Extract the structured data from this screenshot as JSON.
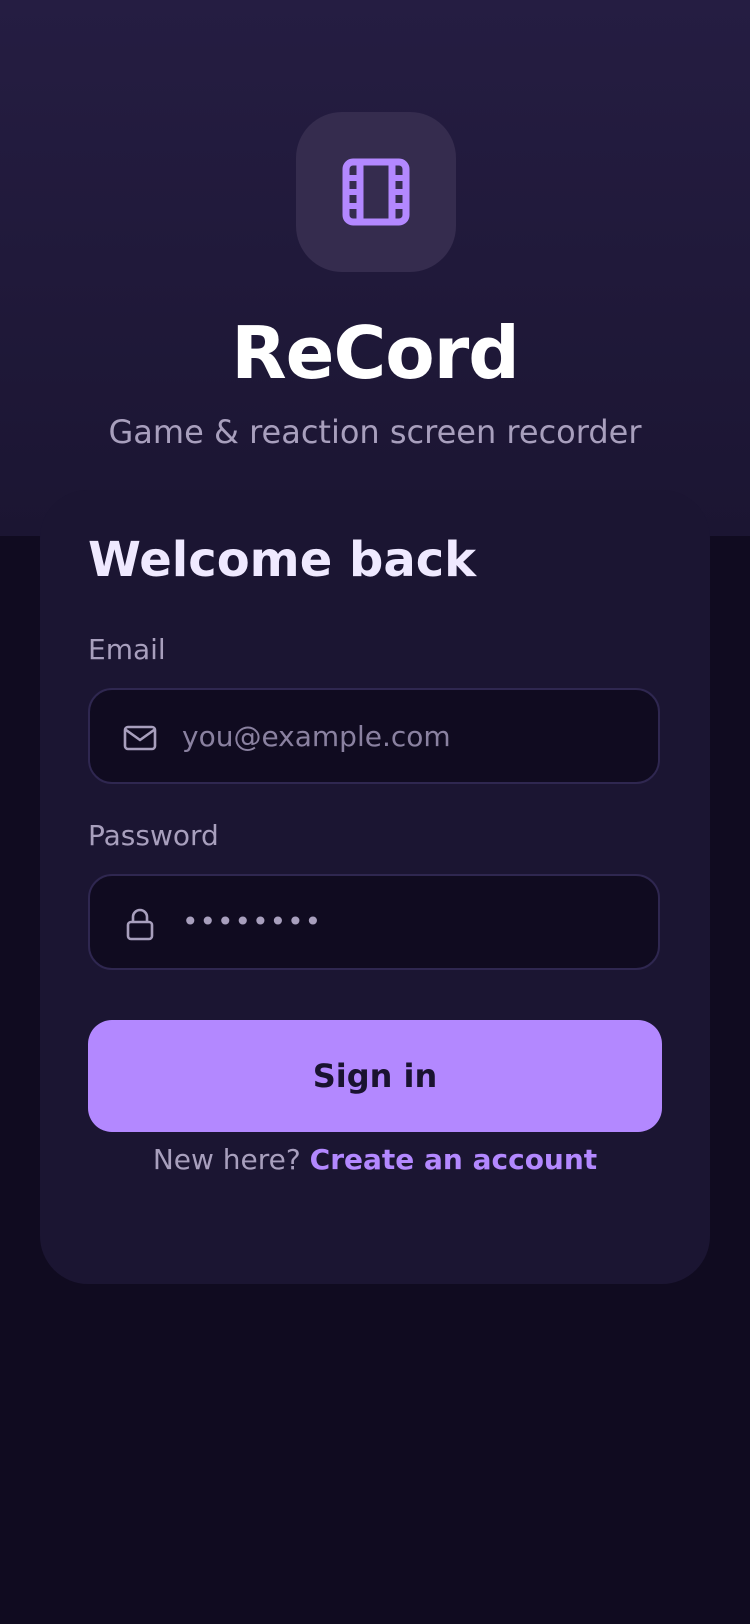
{
  "app": {
    "name": "ReCord",
    "tagline": "Game & reaction screen recorder",
    "icon": "film-icon",
    "accent_color": "#b388ff"
  },
  "login": {
    "title": "Welcome back",
    "email_label": "Email",
    "email_placeholder": "you@example.com",
    "email_icon": "mail-icon",
    "password_label": "Password",
    "password_value": "••••••••",
    "password_icon": "lock-icon",
    "signin_label": "Sign in",
    "signup_prompt": "New here?",
    "signup_link": "Create an account"
  }
}
